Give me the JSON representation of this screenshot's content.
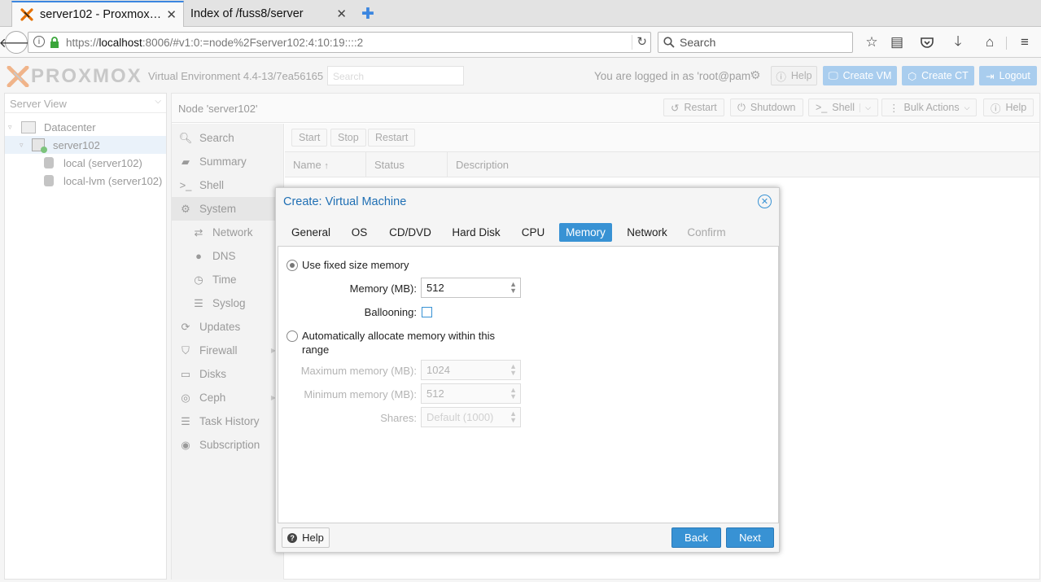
{
  "browser": {
    "tabs": [
      {
        "label": "server102 - Proxmox…"
      },
      {
        "label": "Index of /fuss8/server"
      }
    ],
    "url_prefix": "https://",
    "url_host": "localhost",
    "url_rest": ":8006/#v1:0:=node%2Fserver102:4:10:19::::2",
    "search_placeholder": "Search"
  },
  "header": {
    "logo_text": "PROXMOX",
    "version": "Virtual Environment 4.4-13/7ea56165",
    "search_placeholder": "Search",
    "logged_in": "You are logged in as 'root@pam'",
    "help": "Help",
    "create_vm": "Create VM",
    "create_ct": "Create CT",
    "logout": "Logout"
  },
  "tree": {
    "view_select": "Server View",
    "items": [
      {
        "label": "Datacenter"
      },
      {
        "label": "server102"
      },
      {
        "label": "local (server102)"
      },
      {
        "label": "local-lvm (server102)"
      }
    ]
  },
  "node": {
    "title": "Node 'server102'",
    "toolbar": {
      "restart": "Restart",
      "shutdown": "Shutdown",
      "shell": "Shell",
      "bulk": "Bulk Actions",
      "help": "Help"
    },
    "vm_toolbar": {
      "start": "Start",
      "stop": "Stop",
      "restart": "Restart"
    },
    "columns": {
      "name": "Name",
      "status": "Status",
      "description": "Description"
    },
    "menu": [
      {
        "label": "Search"
      },
      {
        "label": "Summary"
      },
      {
        "label": "Shell"
      },
      {
        "label": "System"
      },
      {
        "label": "Network"
      },
      {
        "label": "DNS"
      },
      {
        "label": "Time"
      },
      {
        "label": "Syslog"
      },
      {
        "label": "Updates"
      },
      {
        "label": "Firewall"
      },
      {
        "label": "Disks"
      },
      {
        "label": "Ceph"
      },
      {
        "label": "Task History"
      },
      {
        "label": "Subscription"
      }
    ]
  },
  "dialog": {
    "title": "Create: Virtual Machine",
    "tabs": [
      {
        "label": "General"
      },
      {
        "label": "OS"
      },
      {
        "label": "CD/DVD"
      },
      {
        "label": "Hard Disk"
      },
      {
        "label": "CPU"
      },
      {
        "label": "Memory"
      },
      {
        "label": "Network"
      },
      {
        "label": "Confirm"
      }
    ],
    "active_tab": "Memory",
    "fixed_radio_label": "Use fixed size memory",
    "memory_label": "Memory (MB):",
    "memory_value": "512",
    "ballooning_label": "Ballooning:",
    "auto_radio_line1": "Automatically allocate memory within this",
    "auto_radio_line2": "range",
    "max_label": "Maximum memory (MB):",
    "max_value": "1024",
    "min_label": "Minimum memory (MB):",
    "min_value": "512",
    "shares_label": "Shares:",
    "shares_value": "Default (1000)",
    "help": "Help",
    "back": "Back",
    "next": "Next"
  },
  "colors": {
    "accent": "#3892d4",
    "logo_orange": "#e57000"
  }
}
